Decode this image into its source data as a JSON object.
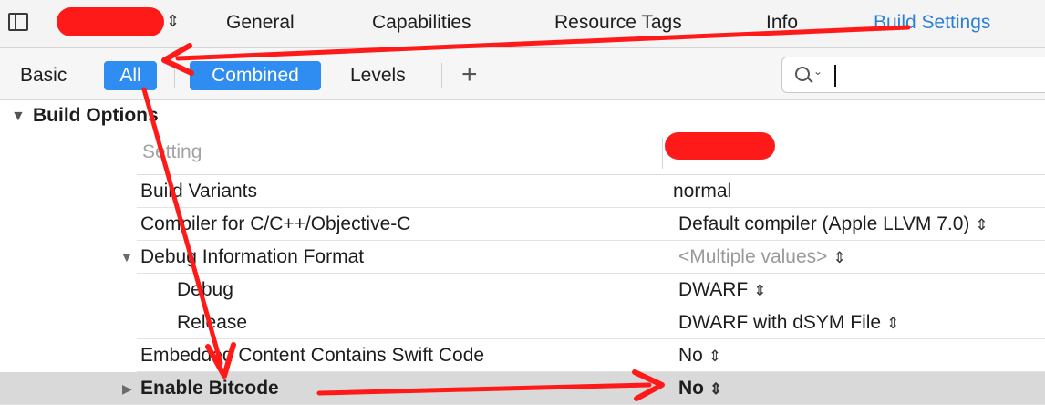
{
  "tabs": [
    {
      "label": "General"
    },
    {
      "label": "Capabilities"
    },
    {
      "label": "Resource Tags"
    },
    {
      "label": "Info"
    },
    {
      "label": "Build Settings"
    }
  ],
  "active_tab": "Build Settings",
  "scope_bar": {
    "basic": "Basic",
    "all": "All",
    "combined": "Combined",
    "levels": "Levels",
    "add": "+"
  },
  "section": {
    "title": "Build Options"
  },
  "columns": {
    "setting": "Setting"
  },
  "rows": [
    {
      "label": "Build Variants",
      "value": "normal"
    },
    {
      "label": "Compiler for C/C++/Objective-C",
      "value": "Default compiler (Apple LLVM 7.0)"
    },
    {
      "label": "Debug Information Format",
      "value": "<Multiple values>"
    },
    {
      "label": "Debug",
      "value": "DWARF"
    },
    {
      "label": "Release",
      "value": "DWARF with dSYM File"
    },
    {
      "label": "Embedded Content Contains Swift Code",
      "value": "No"
    },
    {
      "label": "Enable Bitcode",
      "value": "No"
    }
  ],
  "icons": {
    "stepper": "⌃⌄",
    "disclosure_expanded": "▼",
    "disclosure_collapsed": "▶"
  },
  "colors": {
    "accent": "#2f8cf0",
    "active_tab": "#2b7fd6",
    "annotation": "#ff1a1a",
    "highlight_row": "#d9d9d9"
  }
}
